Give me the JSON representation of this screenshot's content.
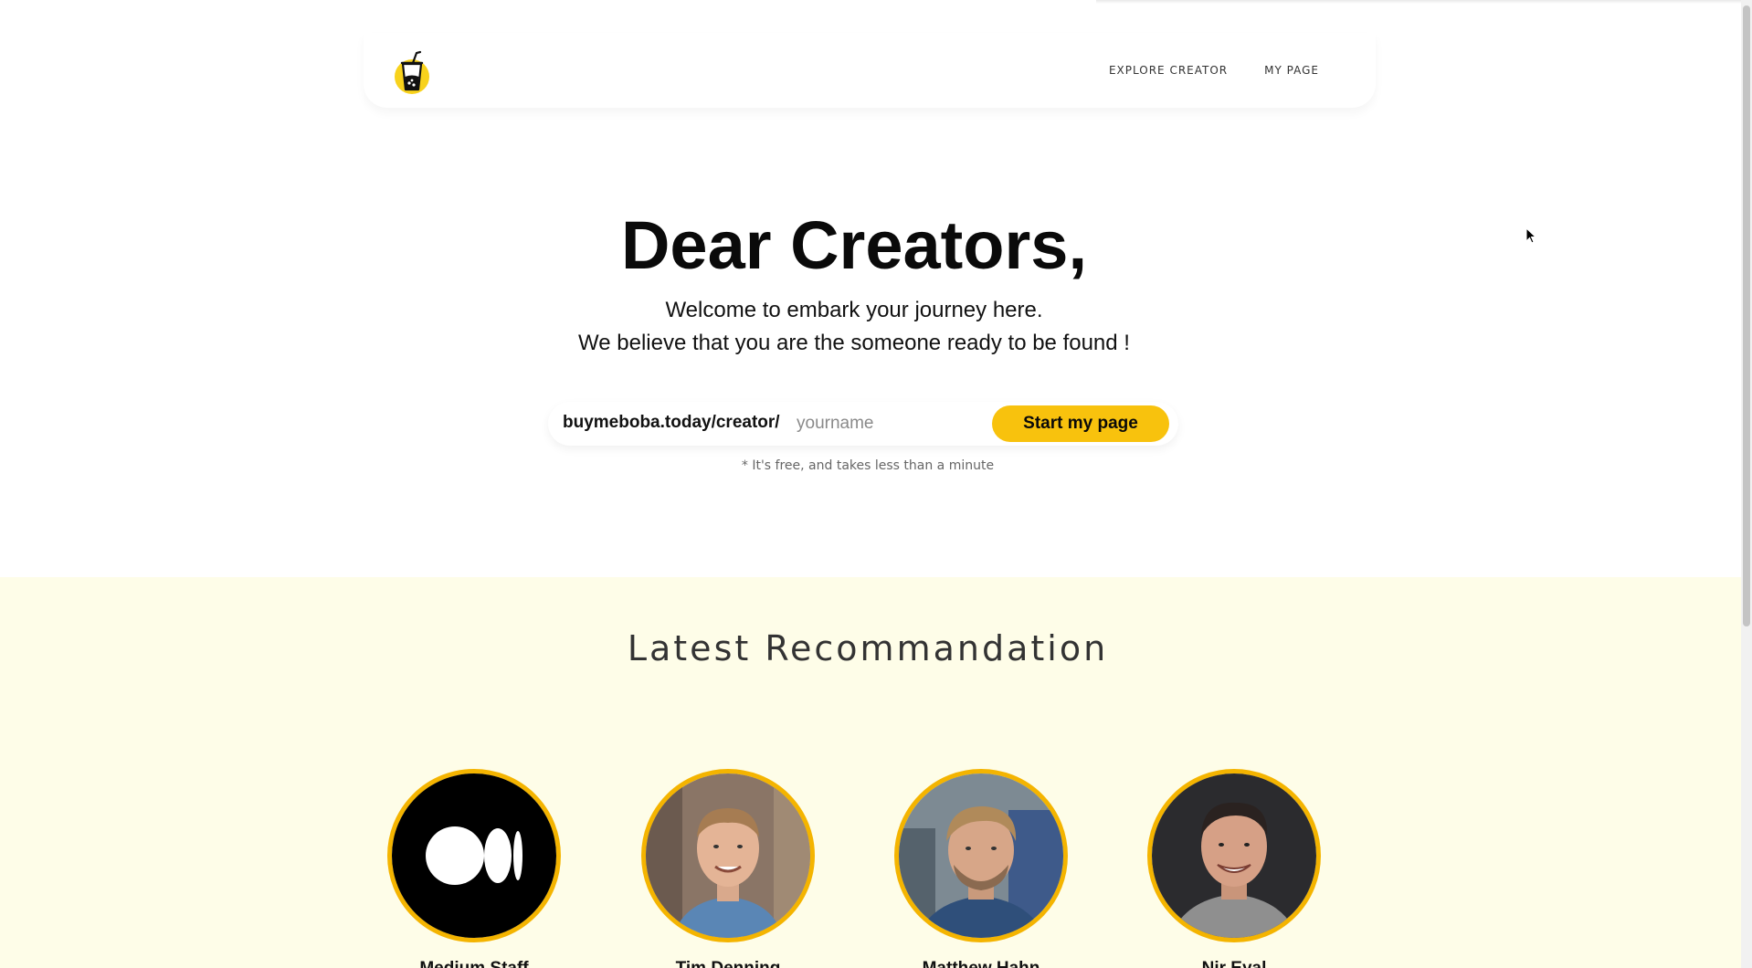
{
  "nav": {
    "links": [
      "EXPLORE CREATOR",
      "MY PAGE"
    ]
  },
  "hero": {
    "title": "Dear Creators,",
    "line1": "Welcome to embark your journey here.",
    "line2": "We believe that you are the someone ready to be found !"
  },
  "signup": {
    "prefix": "buymeboba.today/creator/",
    "placeholder": "yourname",
    "button_label": "Start my page",
    "note": "* It's free, and takes less than a minute"
  },
  "recommendation": {
    "title": "Latest Recommandation",
    "creators": [
      {
        "name": "Medium Staff",
        "avatar_icon": "medium-logo-icon"
      },
      {
        "name": "Tim Denning",
        "avatar_icon": "person-photo-icon"
      },
      {
        "name": "Matthew Hahn",
        "avatar_icon": "person-photo-icon"
      },
      {
        "name": "Nir Eyal",
        "avatar_icon": "person-photo-icon"
      }
    ]
  },
  "colors": {
    "accent": "#f8c20d",
    "avatar_border": "#f4b400",
    "section_bg": "#fefde8"
  }
}
